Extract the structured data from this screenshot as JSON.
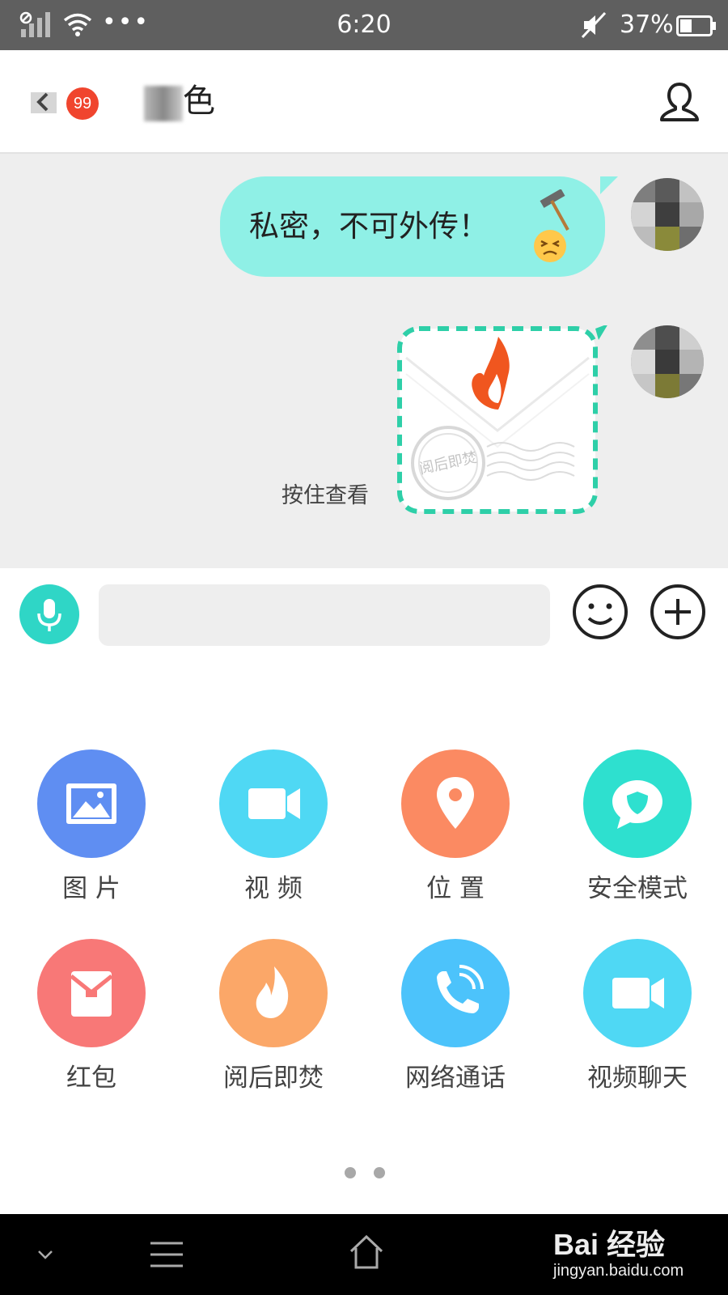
{
  "status_bar": {
    "time": "6:20",
    "battery": "37%",
    "more_dots": "•••"
  },
  "header": {
    "unread_badge": "99",
    "title": "色",
    "back_icon": "back-arrow-icon",
    "profile_icon": "user-profile-icon"
  },
  "messages": [
    {
      "type": "text",
      "text": "私密，不可外传！",
      "emoji": "hammer-face-emoji",
      "side": "right"
    },
    {
      "type": "burn-after-reading",
      "hint": "按住查看",
      "stamp_text": "阅后即焚",
      "side": "right"
    }
  ],
  "input_bar": {
    "voice_icon": "microphone-icon",
    "emoji_icon": "smiley-icon",
    "more_icon": "plus-icon",
    "value": ""
  },
  "panel": {
    "items": [
      {
        "label": "图 片",
        "icon": "image-icon",
        "color": "#5f8ef2"
      },
      {
        "label": "视 频",
        "icon": "video-camera-icon",
        "color": "#4fd8f4"
      },
      {
        "label": "位 置",
        "icon": "location-pin-icon",
        "color": "#fb8a62"
      },
      {
        "label": "安全模式",
        "icon": "secure-chat-icon",
        "color": "#2ee0cf"
      },
      {
        "label": "红包",
        "icon": "red-packet-icon",
        "color": "#f87877"
      },
      {
        "label": "阅后即焚",
        "icon": "flame-icon",
        "color": "#fba768"
      },
      {
        "label": "网络通话",
        "icon": "phone-call-icon",
        "color": "#4cc3fb"
      },
      {
        "label": "视频聊天",
        "icon": "video-chat-icon",
        "color": "#4fd8f4"
      }
    ],
    "page_count": 2
  },
  "watermark": {
    "main": "Bai  经验",
    "url": "jingyan.baidu.com"
  }
}
